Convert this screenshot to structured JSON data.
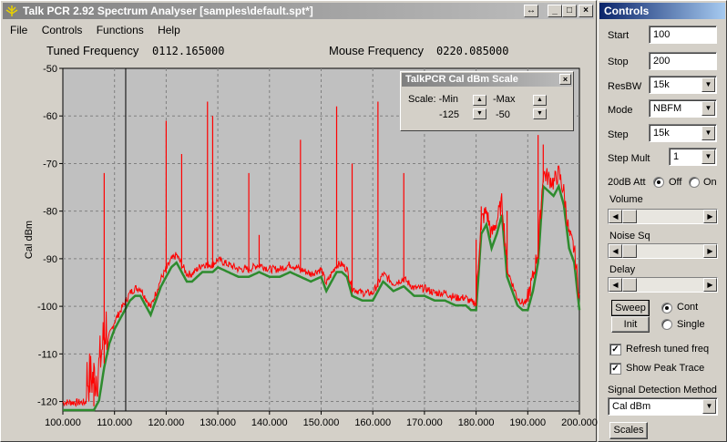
{
  "main_window": {
    "title": "Talk PCR 2.92 Spectrum Analyser [samples\\default.spt*]",
    "restore_label": "↔",
    "menu": [
      "File",
      "Controls",
      "Functions",
      "Help"
    ],
    "tuned_label": "Tuned Frequency",
    "tuned_value": "0112.165000",
    "mouse_label": "Mouse Frequency",
    "mouse_value": "0220.085000"
  },
  "scale_dialog": {
    "title": "TalkPCR Cal dBm Scale",
    "scale_label": "Scale: -Min",
    "max_label": "-Max",
    "min_value": "-125",
    "max_value": "-50"
  },
  "controls": {
    "title": "Controls",
    "start_label": "Start",
    "start_value": "100",
    "stop_label": "Stop",
    "stop_value": "200",
    "resbw_label": "ResBW",
    "resbw_value": "15k",
    "mode_label": "Mode",
    "mode_value": "NBFM",
    "step_label": "Step",
    "step_value": "15k",
    "stepmult_label": "Step Mult",
    "stepmult_value": "1",
    "att_label": "20dB Att",
    "att_off": "Off",
    "att_on": "On",
    "volume_label": "Volume",
    "noise_label": "Noise Sq",
    "delay_label": "Delay",
    "sweep_button": "Sweep",
    "init_button": "Init",
    "cont_label": "Cont",
    "single_label": "Single",
    "refresh_label": "Refresh tuned freq",
    "peak_label": "Show Peak Trace",
    "detect_label": "Signal Detection Method",
    "detect_value": "Cal dBm",
    "scales_button": "Scales"
  },
  "colors": {
    "plot_bg": "#c0c0c0",
    "trace": "#ff0000",
    "baseline": "#2e8b2e",
    "title_active": "#0a246a"
  },
  "chart_data": {
    "type": "line",
    "ylabel": "Cal dBm",
    "xlim": [
      100,
      200
    ],
    "ylim": [
      -122,
      -50
    ],
    "x_ticks": [
      "100.000",
      "110.000",
      "120.000",
      "130.000",
      "140.000",
      "150.000",
      "160.000",
      "170.000",
      "180.000",
      "190.000",
      "200.000"
    ],
    "y_ticks": [
      "-50",
      "-60",
      "-70",
      "-80",
      "-90",
      "-100",
      "-110",
      "-120"
    ],
    "grid": true,
    "tuned_marker": 112.165,
    "series": [
      {
        "x": [
          100,
          102,
          104,
          105,
          106,
          107,
          108,
          109,
          110,
          111,
          112,
          113,
          114,
          115,
          116,
          117,
          118,
          119,
          120,
          121,
          122,
          123,
          124,
          125,
          126,
          127,
          128,
          129,
          130,
          132,
          134,
          136,
          138,
          140,
          142,
          144,
          146,
          148,
          150,
          151,
          152,
          153,
          154,
          155,
          156,
          158,
          160,
          162,
          164,
          166,
          168,
          170,
          172,
          174,
          176,
          178,
          179,
          180,
          181,
          182,
          183,
          184,
          185,
          186,
          187,
          188,
          189,
          190,
          191,
          192,
          193,
          194,
          195,
          196,
          197,
          198,
          199,
          200
        ],
        "y": [
          -121,
          -121,
          -121,
          -121,
          -121,
          -119,
          -112,
          -107,
          -104,
          -102,
          -100,
          -98,
          -97,
          -97,
          -99,
          -101,
          -98,
          -95,
          -93,
          -91,
          -90,
          -92,
          -94,
          -94,
          -93,
          -92,
          -92,
          -92,
          -91,
          -92,
          -93,
          -93,
          -92,
          -93,
          -93,
          -92,
          -93,
          -94,
          -93,
          -96,
          -94,
          -92,
          -92,
          -93,
          -97,
          -98,
          -98,
          -94,
          -96,
          -95,
          -97,
          -97,
          -98,
          -98,
          -99,
          -99,
          -100,
          -100,
          -84,
          -82,
          -87,
          -84,
          -80,
          -93,
          -96,
          -99,
          -100,
          -100,
          -96,
          -90,
          -74,
          -75,
          -76,
          -74,
          -78,
          -87,
          -90,
          -100
        ]
      },
      {
        "x": [
          106,
          108,
          120,
          123,
          128,
          129,
          136,
          138,
          146,
          153,
          156,
          161,
          166,
          180,
          181,
          186,
          192,
          193
        ],
        "y": [
          -115,
          -72,
          -61,
          -68,
          -57,
          -60,
          -72,
          -85,
          -65,
          -58,
          -70,
          -57,
          -72,
          -86,
          -79,
          -80,
          -64,
          -66
        ]
      }
    ]
  }
}
